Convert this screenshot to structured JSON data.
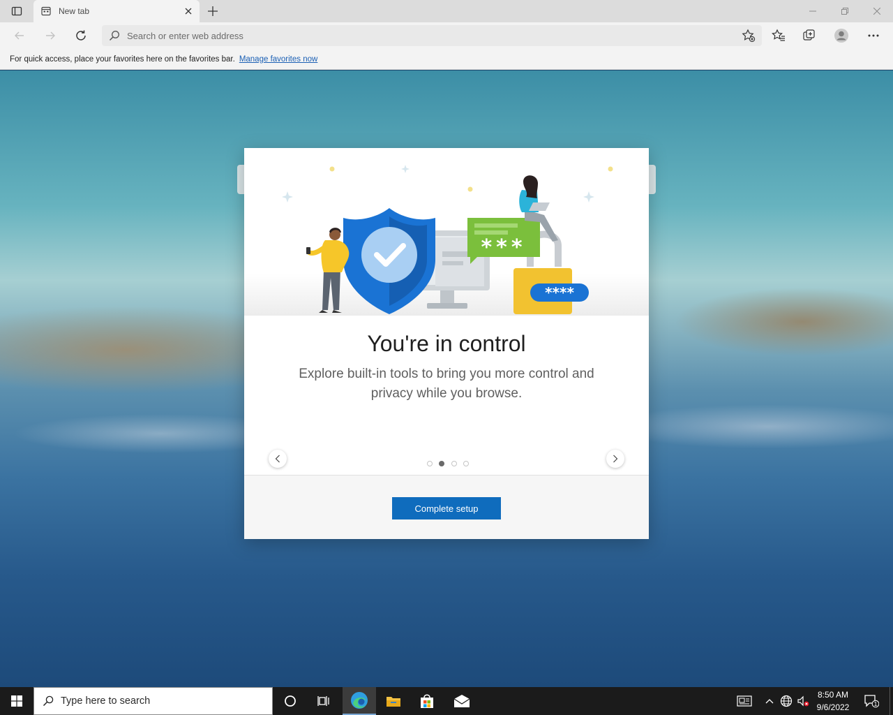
{
  "browser": {
    "tab_title": "New tab",
    "address_placeholder": "Search or enter web address",
    "favorites_bar_text": "For quick access, place your favorites here on the favorites bar.",
    "favorites_bar_link": "Manage favorites now"
  },
  "dialog": {
    "title": "You're in control",
    "body": "Explore built-in tools to bring you more control and privacy while you browse.",
    "primary_button": "Complete setup",
    "carousel": {
      "pages": 4,
      "active_page": 2
    },
    "illustration": {
      "chat_bubble_text": "***",
      "padlock_badge_text": "****"
    }
  },
  "taskbar": {
    "search_placeholder": "Type here to search",
    "clock_time": "8:50 AM",
    "clock_date": "9/6/2022",
    "notification_count": "1"
  },
  "colors": {
    "accent": "#0f6cbd",
    "shield_blue": "#1a73d4",
    "chat_green": "#7bbf3c",
    "padlock_yellow": "#f2c230"
  }
}
